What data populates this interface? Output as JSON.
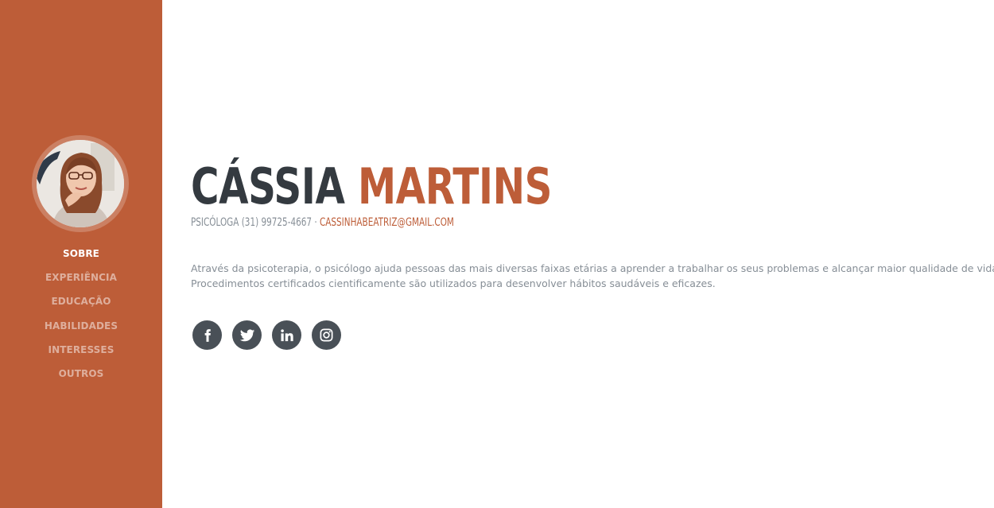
{
  "profile": {
    "first_name": "CÁSSIA",
    "last_name": "MARTINS",
    "title": "PSICÓLOGA",
    "phone": "(31) 99725-4667",
    "separator": "·",
    "email": "CASSINHABEATRIZ@GMAIL.COM",
    "bio_line1": "Através da psicoterapia, o psicólogo ajuda pessoas das mais diversas faixas etárias a aprender a trabalhar os seus problemas e alcançar maior qualidade de vida e saúde.",
    "bio_line2": "Procedimentos certificados cientificamente são utilizados para desenvolver hábitos saudáveis e eficazes."
  },
  "sidebar": {
    "nav": [
      {
        "label": "SOBRE",
        "active": true
      },
      {
        "label": "EXPERIÊNCIA",
        "active": false
      },
      {
        "label": "EDUCAÇÃO",
        "active": false
      },
      {
        "label": "HABILIDADES",
        "active": false
      },
      {
        "label": "INTERESSES",
        "active": false
      },
      {
        "label": "OUTROS",
        "active": false
      }
    ]
  },
  "social": [
    {
      "icon": "facebook-icon"
    },
    {
      "icon": "twitter-icon"
    },
    {
      "icon": "linkedin-icon"
    },
    {
      "icon": "instagram-icon"
    }
  ],
  "colors": {
    "primary": "#bd5d38",
    "heading": "#343a40",
    "muted": "#868e96",
    "social_bg": "#495057"
  }
}
